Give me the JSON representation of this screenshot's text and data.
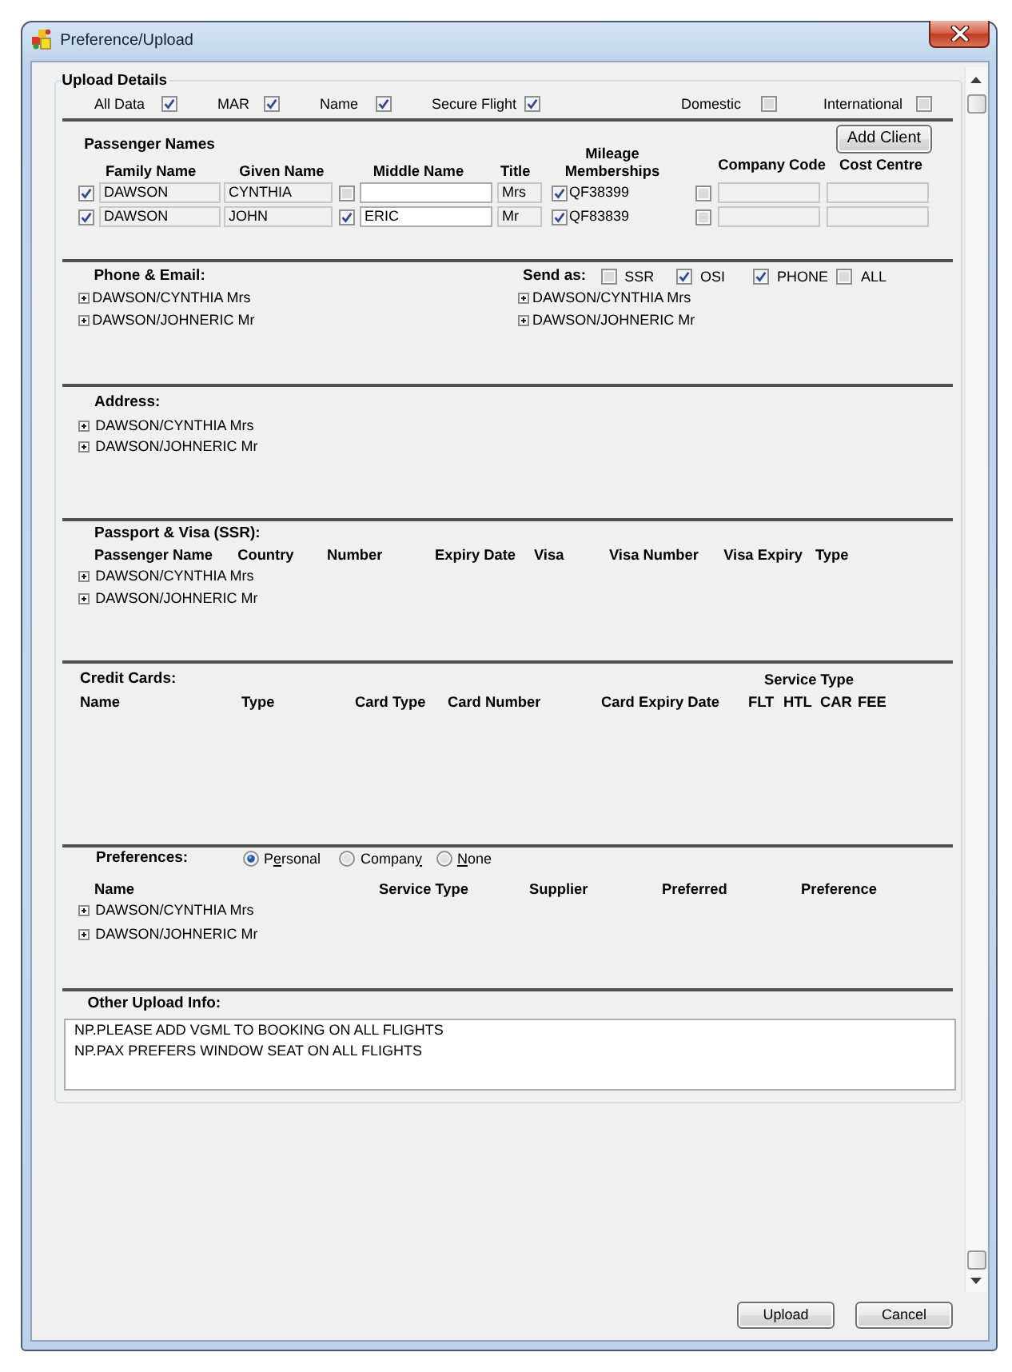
{
  "window": {
    "title": "Preference/Upload"
  },
  "upload_details": {
    "title": "Upload Details",
    "options": [
      {
        "label": "All Data",
        "checked": true
      },
      {
        "label": "MAR",
        "checked": true
      },
      {
        "label": "Name",
        "checked": true
      },
      {
        "label": "Secure Flight",
        "checked": true
      },
      {
        "label": "Domestic",
        "checked": false
      },
      {
        "label": "International",
        "checked": false
      }
    ]
  },
  "passenger_names": {
    "title": "Passenger Names",
    "add_client": "Add Client",
    "columns": {
      "family_name": "Family Name",
      "given_name": "Given Name",
      "middle_name": "Middle Name",
      "title": "Title",
      "mileage": "Mileage Memberships",
      "company_code": "Company Code",
      "cost_centre": "Cost Centre"
    },
    "rows": [
      {
        "checked": true,
        "family_name": {
          "value": "DAWSON",
          "disabled": true
        },
        "given_name": {
          "value": "CYNTHIA",
          "disabled": true
        },
        "middle_name": {
          "checked": false,
          "disabled": false
        },
        "title": {
          "value": "Mrs",
          "disabled": true
        },
        "mileage": {
          "checked": true,
          "value": "QF38399"
        },
        "company_code": {
          "checked": false,
          "disabled": true
        },
        "cost_centre": {
          "disabled": true
        }
      },
      {
        "checked": true,
        "family_name": {
          "value": "DAWSON",
          "disabled": true
        },
        "given_name": {
          "value": "JOHN",
          "disabled": true
        },
        "middle_name": {
          "checked": true,
          "value": "ERIC",
          "disabled": false
        },
        "title": {
          "value": "Mr",
          "disabled": true
        },
        "mileage": {
          "checked": true,
          "value": "QF83839"
        },
        "company_code": {
          "checked": false,
          "disabled": true
        },
        "cost_centre": {
          "disabled": true
        }
      }
    ]
  },
  "phone_email": {
    "title": "Phone & Email:",
    "passengers": [
      {
        "name": "DAWSON/CYNTHIA Mrs",
        "expanded": false
      },
      {
        "name": "DAWSON/JOHNERIC Mr",
        "expanded": false
      }
    ],
    "send_as": {
      "label": "Send as:",
      "options": [
        {
          "label": "SSR",
          "checked": false
        },
        {
          "label": "OSI",
          "checked": true
        },
        {
          "label": "PHONE",
          "checked": true
        },
        {
          "label": "ALL",
          "checked": false
        }
      ],
      "passengers": [
        {
          "name": "DAWSON/CYNTHIA Mrs",
          "expanded": false
        },
        {
          "name": "DAWSON/JOHNERIC Mr",
          "expanded": false
        }
      ]
    }
  },
  "address": {
    "title": "Address:",
    "passengers": [
      {
        "name": "DAWSON/CYNTHIA Mrs",
        "expanded": false
      },
      {
        "name": "DAWSON/JOHNERIC Mr",
        "expanded": false
      }
    ]
  },
  "passport_visa": {
    "title": "Passport & Visa (SSR):",
    "columns": [
      "Passenger Name",
      "Country",
      "Number",
      "Expiry Date",
      "Visa",
      "Visa Number",
      "Visa Expiry",
      "Type"
    ],
    "passengers": [
      {
        "name": "DAWSON/CYNTHIA Mrs",
        "expanded": false
      },
      {
        "name": "DAWSON/JOHNERIC Mr",
        "expanded": false
      }
    ]
  },
  "credit_cards": {
    "title": "Credit Cards:",
    "columns": [
      "Name",
      "Type",
      "Card Type",
      "Card Number",
      "Card Expiry Date"
    ],
    "service_type": {
      "label": "Service Type",
      "columns": [
        "FLT",
        "HTL",
        "CAR",
        "FEE"
      ]
    }
  },
  "preferences": {
    "title": "Preferences:",
    "options": [
      {
        "label_start": "P",
        "mnemonic": "e",
        "label_end": "rsonal",
        "selected": true
      },
      {
        "label_start": "Compan",
        "mnemonic": "y",
        "selected": false
      },
      {
        "mnemonic": "N",
        "label_end": "one",
        "selected": false
      }
    ],
    "columns": [
      "Name",
      "Service Type",
      "Supplier",
      "Preferred",
      "Preference"
    ],
    "passengers": [
      {
        "name": "DAWSON/CYNTHIA Mrs",
        "expanded": false
      },
      {
        "name": "DAWSON/JOHNERIC Mr",
        "expanded": false
      }
    ]
  },
  "other_upload_info": {
    "title": "Other Upload Info:",
    "lines": [
      "NP.PLEASE ADD VGML TO BOOKING ON ALL FLIGHTS",
      "NP.PAX PREFERS WINDOW SEAT ON ALL FLIGHTS"
    ]
  },
  "buttons": [
    "Upload",
    "Cancel"
  ]
}
